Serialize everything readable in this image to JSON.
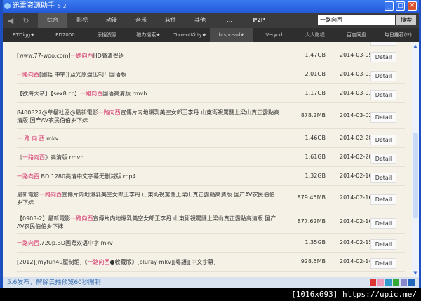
{
  "window": {
    "title": "迅雷资源助手",
    "version": "5.2"
  },
  "nav": {
    "items": [
      "综合",
      "影视",
      "动漫",
      "音乐",
      "软件",
      "其他",
      "...",
      "P2P"
    ],
    "active": 0
  },
  "search": {
    "value": "一路向西",
    "button": "搜索"
  },
  "subnav": {
    "items": [
      "BTDigg★",
      "ED2000",
      "乐搜资源",
      "磁力搜索★",
      "TorrentKitty★",
      "btspread★",
      "iVerycd",
      "人人影视",
      "百度网盘",
      "每日推荐(!!)"
    ],
    "active": 5
  },
  "detail_label": "Detail",
  "rows": [
    {
      "pre": "[www.77-woo.com]",
      "hl": "一路向西",
      "post": "HD高清粤语",
      "size": "1.47GB",
      "date": "2014-03-05"
    },
    {
      "pre": "",
      "hl": "一路向西",
      "post": "[國語 中字][蓝光原盘压制！国语版",
      "size": "2.01GB",
      "date": "2014-03-03"
    },
    {
      "pre": "【欲海大帝】【sex8.cc】",
      "hl": "一路向西",
      "post": "国语高清版.rmvb",
      "size": "1.17GB",
      "date": "2014-03-03"
    },
    {
      "pre": "8400327@草榴社區@最新電影",
      "hl": "一路向西",
      "post": "宣傳片内地爆乳美空女郎王李丹 山東衛視罵鬪上梁山真正露點高清版 国产AV农民伯伯乡下妹",
      "size": "878.2MB",
      "date": "2014-03-02"
    },
    {
      "pre": "",
      "hl": "一 路 向 西",
      "post": ".mkv",
      "size": "1.46GB",
      "date": "2014-02-28"
    },
    {
      "pre": "《",
      "hl": "一路向西",
      "post": "》高清版.rmvb",
      "size": "1.61GB",
      "date": "2014-02-20"
    },
    {
      "pre": "",
      "hl": "一路向西",
      "post": " BD 1280高清中文字幕无删减版.mp4",
      "size": "1.32GB",
      "date": "2014-02-16"
    },
    {
      "pre": "最新電影",
      "hl": "一路向西",
      "post": "宣傳片内地爆乳美空女郎王李丹 山東衛視罵鬪上梁山真正露點高清版 国产AV农民伯伯乡下妹",
      "size": "879.45MB",
      "date": "2014-02-16"
    },
    {
      "pre": "【0903-2】最新電影",
      "hl": "一路向西",
      "post": "宣傳片内地爆乳美空女郎王李丹 山東衛視罵鬪上梁山真正露點高清版 国产AV农民伯伯乡下妹",
      "size": "877.62MB",
      "date": "2014-02-16"
    },
    {
      "pre": "",
      "hl": "一路向西",
      "post": ".720p.BD国粤双语中字.mkv",
      "size": "1.35GB",
      "date": "2014-02-15"
    },
    {
      "pre": "[2012][myfun4u壓制組]《",
      "hl": "一路向西",
      "post": "●收藏版》[bluray-mkv][粵語][中文字幕]",
      "size": "928.5MB",
      "date": "2014-02-14"
    }
  ],
  "status": {
    "text": "5.6发布，解除云播预览60秒限制"
  },
  "watermark": "[1016x693] https://upic.me/"
}
